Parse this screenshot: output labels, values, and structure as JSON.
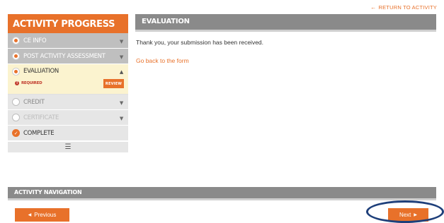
{
  "return_link": {
    "label": "RETURN TO ACTIVITY",
    "icon": "arrow-left-icon"
  },
  "sidebar": {
    "title": "ACTIVITY PROGRESS",
    "steps": [
      {
        "label": "CE INFO",
        "state": "filled"
      },
      {
        "label": "POST ACTIVITY ASSESSMENT",
        "state": "filled"
      },
      {
        "label": "EVALUATION",
        "state": "active",
        "required_label": "REQUIRED",
        "review_label": "REVIEW"
      },
      {
        "label": "CREDIT",
        "state": "empty"
      },
      {
        "label": "CERTIFICATE",
        "state": "disabled"
      },
      {
        "label": "COMPLETE",
        "state": "complete"
      }
    ],
    "menu_icon": "hamburger-icon"
  },
  "main": {
    "title": "EVALUATION",
    "confirmation": "Thank you, your submission has been received.",
    "back_link": "Go back to the form"
  },
  "navigation": {
    "title": "ACTIVITY NAVIGATION",
    "previous_label": "Previous",
    "next_label": "Next"
  },
  "colors": {
    "accent": "#e8712a",
    "header_gray": "#8a8a8a",
    "step_gray": "#bfbfbf",
    "active_step_bg": "#fbf3cf",
    "highlight_ring": "#1e3f7a"
  }
}
